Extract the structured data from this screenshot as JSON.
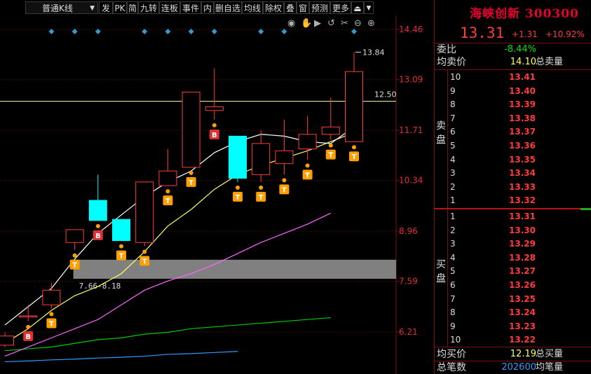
{
  "toolbar": {
    "kline_type": "普通K线",
    "buttons": [
      "发",
      "PK",
      "简",
      "九转",
      "连板",
      "事件",
      "内",
      "删自选",
      "均线",
      "除权",
      "叠",
      "窗",
      "预测",
      "更多"
    ]
  },
  "stock": {
    "name_code": "海峡创新 300300",
    "price": "13.31",
    "change": "+1.31",
    "change_pct": "+10.92%"
  },
  "quote": {
    "weibi_label": "委比",
    "weibi_value": "-8.44%",
    "avg_sell_label": "均卖价",
    "avg_sell_value": "14.10",
    "total_sell_label": "总卖量",
    "sell_label": "卖盘",
    "buy_label": "买盘",
    "avg_buy_label": "均买价",
    "avg_buy_value": "12.19",
    "total_buy_label": "总买量",
    "total_trades_label": "总笔数",
    "total_trades_value": "202600",
    "avg_trades_label": "均笔量"
  },
  "asks": [
    {
      "level": "10",
      "price": "13.41"
    },
    {
      "level": "9",
      "price": "13.40"
    },
    {
      "level": "8",
      "price": "13.39"
    },
    {
      "level": "7",
      "price": "13.38"
    },
    {
      "level": "6",
      "price": "13.37"
    },
    {
      "level": "5",
      "price": "13.36"
    },
    {
      "level": "4",
      "price": "13.35"
    },
    {
      "level": "3",
      "price": "13.34"
    },
    {
      "level": "2",
      "price": "13.33"
    },
    {
      "level": "1",
      "price": "13.32"
    }
  ],
  "bids": [
    {
      "level": "1",
      "price": "13.31"
    },
    {
      "level": "2",
      "price": "13.30"
    },
    {
      "level": "3",
      "price": "13.29"
    },
    {
      "level": "4",
      "price": "13.28"
    },
    {
      "level": "5",
      "price": "13.27"
    },
    {
      "level": "6",
      "price": "13.26"
    },
    {
      "level": "7",
      "price": "13.25"
    },
    {
      "level": "8",
      "price": "13.24"
    },
    {
      "level": "9",
      "price": "13.23"
    },
    {
      "level": "10",
      "price": "13.22"
    }
  ],
  "colors": {
    "up": "#ff3c3c",
    "down": "#00ffff",
    "ma5": "#ffffff",
    "ma10": "#ffff66",
    "ma20": "#ff66ff",
    "ma60": "#00cc00",
    "ma120": "#3399ff",
    "marker_diamond": "#3399cc",
    "badge_t": "#ffa000",
    "badge_b": "#e03030"
  },
  "chart_data": {
    "type": "candlestick",
    "y_axis_ticks": [
      14.46,
      13.09,
      11.71,
      10.34,
      8.96,
      7.59,
      6.21
    ],
    "ylim": [
      5.9,
      14.9
    ],
    "reference_line": {
      "value": 12.5,
      "label": "12.50"
    },
    "max_label": "13.84",
    "max_value": 13.84,
    "zone": {
      "low": 7.66,
      "high": 8.18,
      "label": "7.66-8.18"
    },
    "candles": [
      {
        "o": 5.85,
        "h": 6.2,
        "l": 5.8,
        "c": 6.1
      },
      {
        "o": 6.65,
        "h": 6.95,
        "l": 6.5,
        "c": 6.65
      },
      {
        "o": 6.95,
        "h": 7.55,
        "l": 6.85,
        "c": 7.35
      },
      {
        "o": 8.65,
        "h": 9.0,
        "l": 8.45,
        "c": 9.0
      },
      {
        "o": 9.8,
        "h": 10.5,
        "l": 9.25,
        "c": 9.25
      },
      {
        "o": 9.28,
        "h": 9.28,
        "l": 8.7,
        "c": 8.7
      },
      {
        "o": 8.65,
        "h": 10.3,
        "l": 8.55,
        "c": 10.3
      },
      {
        "o": 10.2,
        "h": 11.2,
        "l": 10.2,
        "c": 10.6
      },
      {
        "o": 10.7,
        "h": 12.75,
        "l": 10.7,
        "c": 12.75
      },
      {
        "o": 12.25,
        "h": 13.4,
        "l": 12.0,
        "c": 12.35
      },
      {
        "o": 11.55,
        "h": 11.55,
        "l": 10.3,
        "c": 10.4
      },
      {
        "o": 10.5,
        "h": 11.7,
        "l": 10.3,
        "c": 11.35
      },
      {
        "o": 10.8,
        "h": 12.0,
        "l": 10.5,
        "c": 11.15
      },
      {
        "o": 11.2,
        "h": 12.1,
        "l": 10.9,
        "c": 11.6
      },
      {
        "o": 11.6,
        "h": 12.6,
        "l": 11.45,
        "c": 11.8
      },
      {
        "o": 11.4,
        "h": 13.84,
        "l": 11.4,
        "c": 13.31
      }
    ],
    "ma5": [
      6.4,
      6.9,
      7.4,
      8.2,
      8.9,
      9.4,
      9.9,
      10.3,
      10.6,
      11.1,
      11.4,
      11.6,
      11.55,
      11.4,
      11.35,
      11.8
    ],
    "ma10": [
      5.9,
      6.3,
      6.8,
      7.2,
      7.45,
      7.8,
      8.4,
      9.1,
      9.55,
      10.1,
      10.5,
      10.75,
      10.95,
      11.15,
      11.4,
      11.65
    ],
    "ma20": [
      5.55,
      5.8,
      6.05,
      6.3,
      6.55,
      6.95,
      7.35,
      7.6,
      7.8,
      8.05,
      8.35,
      8.65,
      8.9,
      9.15,
      9.45
    ],
    "ma60": [
      5.7,
      5.75,
      5.8,
      5.9,
      6.0,
      6.05,
      6.15,
      6.2,
      6.3,
      6.35,
      6.4,
      6.45,
      6.5,
      6.55,
      6.6
    ],
    "ma120": [
      5.4,
      5.42,
      5.45,
      5.47,
      5.5,
      5.52,
      5.55,
      5.6,
      5.62,
      5.65,
      5.68
    ],
    "signals": [
      {
        "i": 1,
        "type": "B"
      },
      {
        "i": 2,
        "type": "T"
      },
      {
        "i": 3,
        "type": "T"
      },
      {
        "i": 4,
        "type": "B"
      },
      {
        "i": 5,
        "type": "T"
      },
      {
        "i": 6,
        "type": "T"
      },
      {
        "i": 7,
        "type": "T"
      },
      {
        "i": 8,
        "type": "T"
      },
      {
        "i": 9,
        "type": "B"
      },
      {
        "i": 10,
        "type": "T"
      },
      {
        "i": 11,
        "type": "T"
      },
      {
        "i": 12,
        "type": "T"
      },
      {
        "i": 13,
        "type": "T"
      },
      {
        "i": 14,
        "type": "T"
      },
      {
        "i": 15,
        "type": "T"
      }
    ],
    "diamonds": [
      2,
      3,
      4,
      6,
      7,
      8,
      9,
      11,
      12,
      15
    ]
  }
}
